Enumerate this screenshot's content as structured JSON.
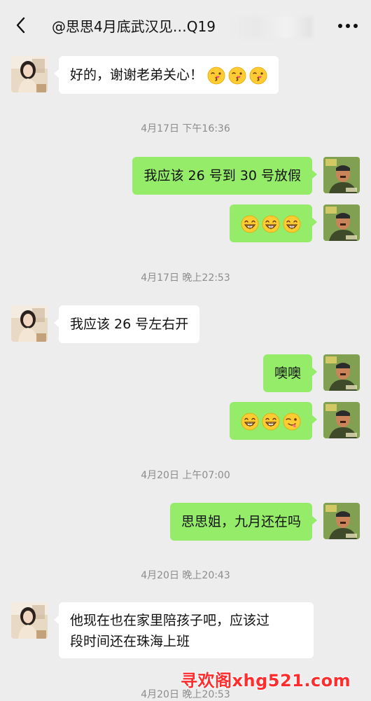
{
  "header": {
    "title": "@思思4月底武汉见…Q19",
    "back_icon": "chevron-left-icon",
    "more_icon": "more-dots-icon"
  },
  "colors": {
    "background": "#ededed",
    "incoming_bubble": "#ffffff",
    "outgoing_bubble": "#95ec69",
    "timestamp": "#8c8c8c",
    "watermark": "#ff2d2d"
  },
  "messages": [
    {
      "type": "in",
      "text": "好的，谢谢老弟关心！",
      "emojis": [
        "kiss",
        "kiss",
        "kiss"
      ]
    },
    {
      "type": "time",
      "text": "4月17日 下午16:36"
    },
    {
      "type": "out",
      "text": "我应该 26 号到 30 号放假"
    },
    {
      "type": "out",
      "text": "",
      "emojis": [
        "grin",
        "grin",
        "grin"
      ]
    },
    {
      "type": "time",
      "text": "4月17日 晚上22:53"
    },
    {
      "type": "in",
      "text": "我应该 26 号左右开"
    },
    {
      "type": "out",
      "text": "噢噢"
    },
    {
      "type": "out",
      "text": "",
      "emojis": [
        "grin",
        "grin",
        "wink"
      ]
    },
    {
      "type": "time",
      "text": "4月20日 上午07:00"
    },
    {
      "type": "out",
      "text": "思思姐，九月还在吗"
    },
    {
      "type": "time",
      "text": "4月20日 晚上20:43"
    },
    {
      "type": "in",
      "text_line1": "他现在也在家里陪孩子吧，应该过",
      "text_line2": "段时间还在珠海上班"
    },
    {
      "type": "time",
      "text": "4月20日 晚上20:53"
    }
  ],
  "watermark": "寻欢阁xhg521.com"
}
